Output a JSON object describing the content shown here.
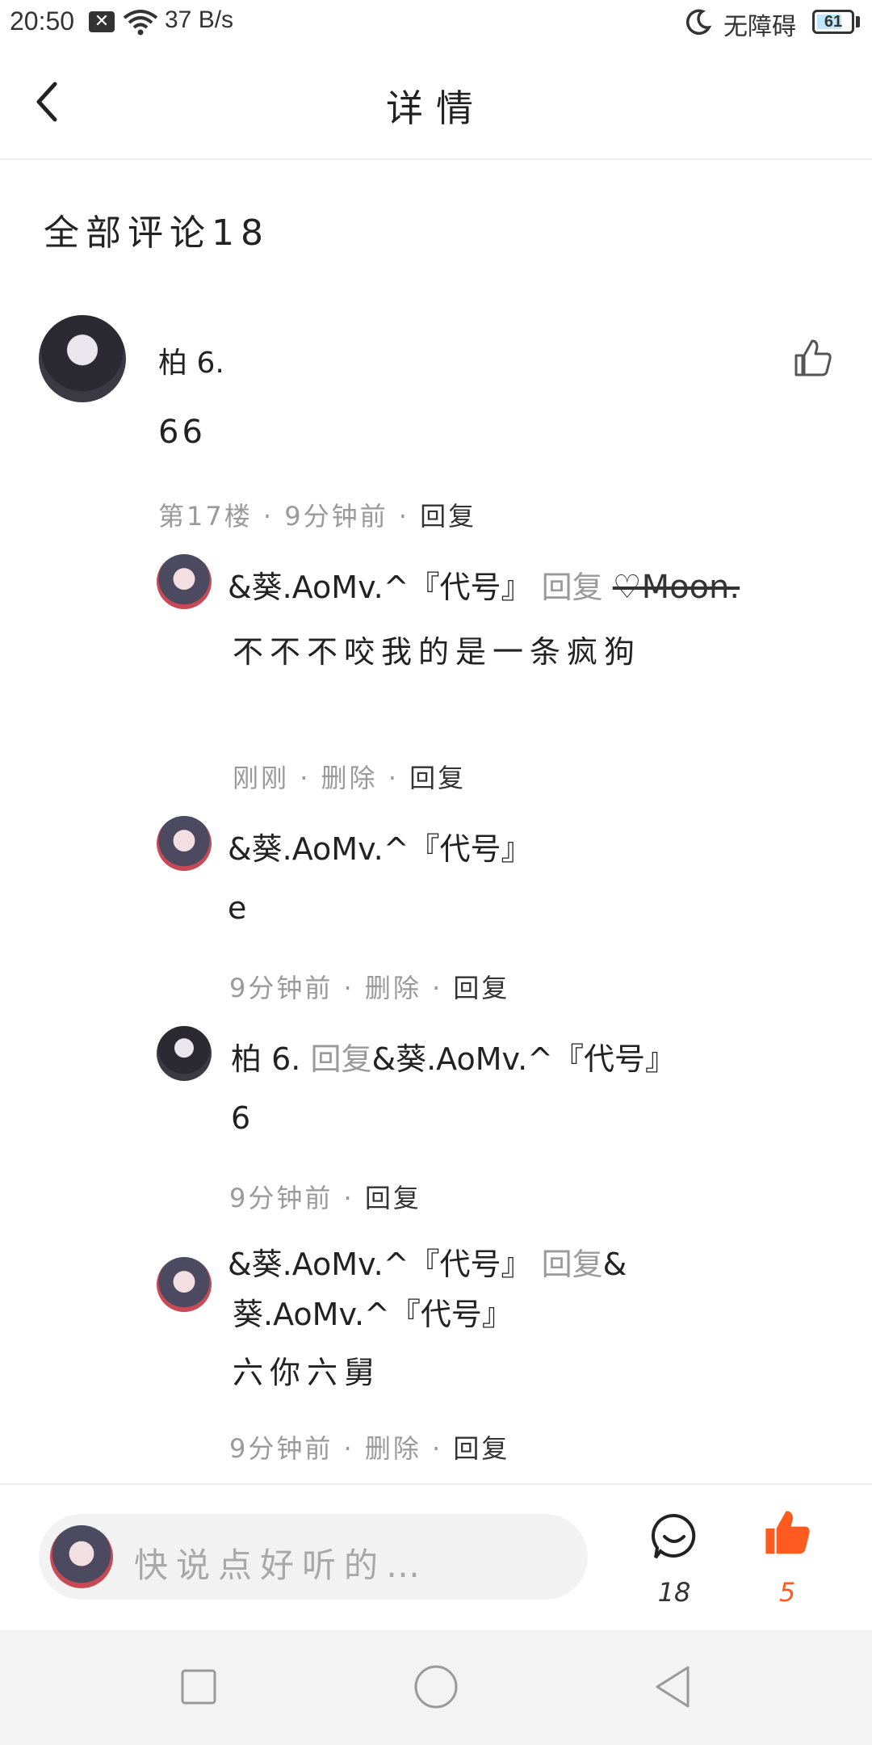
{
  "status_bar": {
    "time": "20:50",
    "x_icon_glyph": "✕",
    "net_speed": "37 B/s",
    "accessibility": "无障碍",
    "battery": "61"
  },
  "header": {
    "title": "详情",
    "back_icon": "chevron-left-icon"
  },
  "comments_title": "全部评论18",
  "main_comment": {
    "author": "柏 6.",
    "content": "66",
    "floor": "第17楼",
    "time": "9分钟前",
    "reply": "回复",
    "separator": "·"
  },
  "replies": [
    {
      "author": "&葵.AoMv.^『代号』",
      "reply_word": "回复",
      "target": "♡Moon.",
      "content": "不不不咬我的是一条疯狗",
      "time": "刚刚",
      "delete": "删除",
      "reply": "回复"
    },
    {
      "author": "&葵.AoMv.^『代号』",
      "content": "e",
      "time": "9分钟前",
      "delete": "删除",
      "reply": "回复"
    },
    {
      "author": "柏 6.",
      "reply_word": "回复",
      "target": "&葵.AoMv.^『代号』",
      "content": "6",
      "time": "9分钟前",
      "reply": "回复"
    },
    {
      "author": "&葵.AoMv.^『代号』",
      "reply_word": "回复",
      "target_line1": "&",
      "target_line2": "葵.AoMv.^『代号』",
      "content": "六你六舅",
      "time": "9分钟前",
      "delete": "删除",
      "reply": "回复"
    }
  ],
  "bottom_bar": {
    "placeholder": "快说点好听的…",
    "comment_count": "18",
    "like_count": "5",
    "like_color": "#ff5a1f"
  }
}
